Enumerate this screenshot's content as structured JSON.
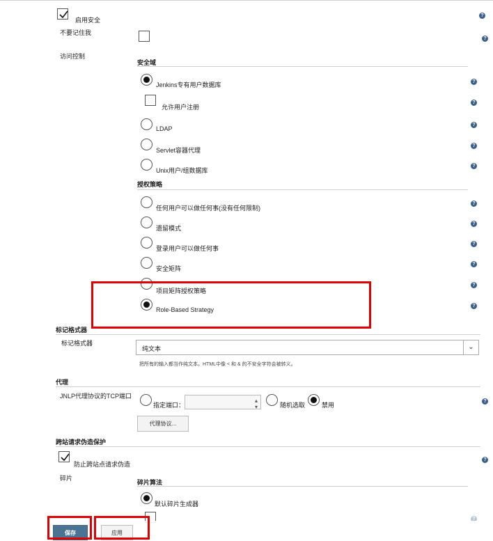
{
  "security": {
    "enable_label": "启用安全",
    "no_remember_label": "不要记住我",
    "access_control_label": "访问控制",
    "realm_header": "安全域",
    "realm_options": [
      "Jenkins专有用户数据库",
      "LDAP",
      "Servlet容器代理",
      "Unix用户/组数据库"
    ],
    "allow_signup_label": "允许用户注册",
    "authz_header": "授权策略",
    "authz_options": [
      "任何用户可以做任何事(没有任何限制)",
      "遗留模式",
      "登录用户可以做任何事",
      "安全矩阵",
      "项目矩阵授权策略",
      "Role-Based Strategy"
    ]
  },
  "markup": {
    "section_title": "标记格式器",
    "field_label": "标记格式器",
    "selected": "纯文本",
    "description": "把所有的输入都当作纯文本。HTML中像 < 和 & 的不安全字符会被转义。"
  },
  "agent": {
    "section_title": "代理",
    "field_label": "JNLP代理协议的TCP端口",
    "fixed_label": "指定端口：",
    "random_label": "随机选取",
    "disable_label": "禁用",
    "protocols_button": "代理协议..."
  },
  "csrf": {
    "section_title": "跨站请求伪造保护",
    "prevent_label": "防止跨站点请求伪造",
    "crumb_label": "碎片",
    "crumb_algo_header": "碎片算法",
    "default_crumb_label": "默认碎片生成器"
  },
  "buttons": {
    "save": "保存",
    "apply": "应用"
  },
  "help_icon_text": "?",
  "colors": {
    "accent": "#4b7494",
    "highlight": "#e00000"
  }
}
